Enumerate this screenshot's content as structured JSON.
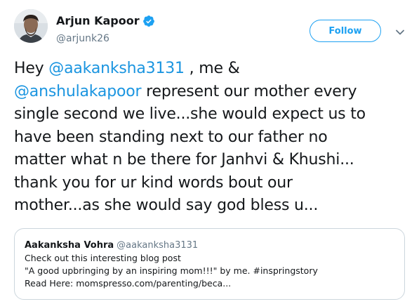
{
  "author": {
    "name": "Arjun Kapoor",
    "handle": "@arjunk26",
    "verified": true
  },
  "follow_label": "Follow",
  "tweet": {
    "line1_pre": "Hey ",
    "line1_mention": "@aakanksha3131",
    "line1_post": " , me &",
    "line2_mention": "@anshulakapoor",
    "line2_post": " represent our mother every",
    "line3": "single second we live...she would expect us to",
    "line4": "have been standing next to our father no",
    "line5": "matter what n be there for Janhvi & Khushi...",
    "line6": "thank you for ur kind words bout our",
    "line7": "mother...as she would say god bless u..."
  },
  "quote": {
    "name": "Aakanksha Vohra",
    "handle": "@aakanksha3131",
    "line1": "Check out this interesting blog post",
    "line2": "\"A good upbringing by an inspiring mom!!!\" by me. #inspringstory",
    "line3": "Read Here: momspresso.com/parenting/beca..."
  },
  "colors": {
    "accent": "#1da1f2",
    "mention": "#1b95e0",
    "secondary_text": "#657786",
    "border": "#ccd6dd"
  },
  "icons": {
    "verified": "verified-badge-icon",
    "caret": "chevron-down-icon"
  }
}
